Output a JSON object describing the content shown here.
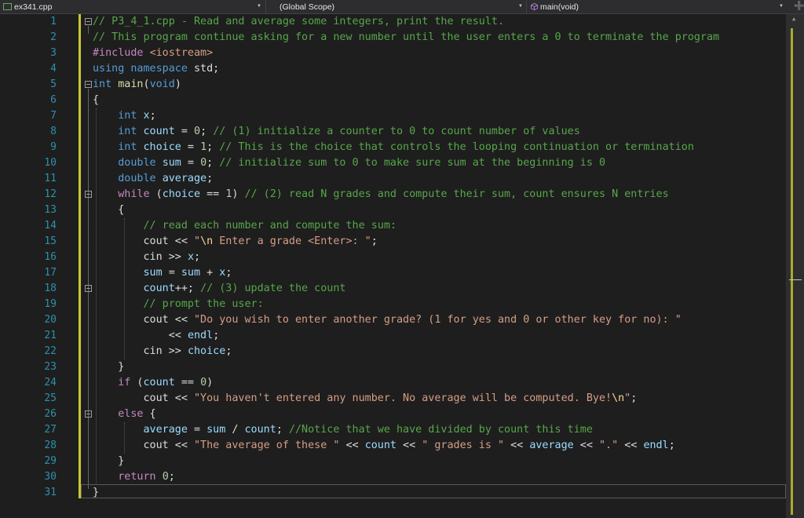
{
  "toolbar": {
    "file": "ex341.cpp",
    "scope": "(Global Scope)",
    "member": "main(void)",
    "split_glyph": "➕"
  },
  "line_numbers": [
    "1",
    "2",
    "3",
    "4",
    "5",
    "6",
    "7",
    "8",
    "9",
    "10",
    "11",
    "12",
    "13",
    "14",
    "15",
    "16",
    "17",
    "18",
    "19",
    "20",
    "21",
    "22",
    "23",
    "24",
    "25",
    "26",
    "27",
    "28",
    "29",
    "30",
    "31"
  ],
  "lines": [
    [
      [
        "c",
        "// P3_4_1.cpp - Read and average some integers, print the result."
      ]
    ],
    [
      [
        "c",
        "// This program continue asking for a new number until the user enters a 0 to terminate the program"
      ]
    ],
    [
      [
        "p",
        "#include "
      ],
      [
        "s",
        "<iostream>"
      ]
    ],
    [
      [
        "k",
        "using"
      ],
      [
        "t",
        " "
      ],
      [
        "k",
        "namespace"
      ],
      [
        "t",
        " std;"
      ]
    ],
    [
      [
        "k",
        "int"
      ],
      [
        "t",
        " "
      ],
      [
        "f",
        "main"
      ],
      [
        "t",
        "("
      ],
      [
        "k",
        "void"
      ],
      [
        "t",
        ")"
      ]
    ],
    [
      [
        "t",
        "{"
      ]
    ],
    [
      [
        "t",
        "    "
      ],
      [
        "k",
        "int"
      ],
      [
        "t",
        " "
      ],
      [
        "v",
        "x"
      ],
      [
        "t",
        ";"
      ]
    ],
    [
      [
        "t",
        "    "
      ],
      [
        "k",
        "int"
      ],
      [
        "t",
        " "
      ],
      [
        "v",
        "count"
      ],
      [
        "t",
        " = "
      ],
      [
        "n",
        "0"
      ],
      [
        "t",
        "; "
      ],
      [
        "c",
        "// (1) initialize a counter to 0 to count number of values"
      ]
    ],
    [
      [
        "t",
        "    "
      ],
      [
        "k",
        "int"
      ],
      [
        "t",
        " "
      ],
      [
        "v",
        "choice"
      ],
      [
        "t",
        " = "
      ],
      [
        "n",
        "1"
      ],
      [
        "t",
        "; "
      ],
      [
        "c",
        "// This is the choice that controls the looping continuation or termination"
      ]
    ],
    [
      [
        "t",
        "    "
      ],
      [
        "k",
        "double"
      ],
      [
        "t",
        " "
      ],
      [
        "v",
        "sum"
      ],
      [
        "t",
        " = "
      ],
      [
        "n",
        "0"
      ],
      [
        "t",
        "; "
      ],
      [
        "c",
        "// initialize sum to 0 to make sure sum at the beginning is 0"
      ]
    ],
    [
      [
        "t",
        "    "
      ],
      [
        "k",
        "double"
      ],
      [
        "t",
        " "
      ],
      [
        "v",
        "average"
      ],
      [
        "t",
        ";"
      ]
    ],
    [
      [
        "t",
        "    "
      ],
      [
        "p",
        "while"
      ],
      [
        "t",
        " ("
      ],
      [
        "v",
        "choice"
      ],
      [
        "t",
        " == "
      ],
      [
        "n",
        "1"
      ],
      [
        "t",
        ") "
      ],
      [
        "c",
        "// (2) read N grades and compute their sum, count ensures N entries"
      ]
    ],
    [
      [
        "t",
        "    {"
      ]
    ],
    [
      [
        "t",
        "        "
      ],
      [
        "c",
        "// read each number and compute the sum:"
      ]
    ],
    [
      [
        "t",
        "        cout << "
      ],
      [
        "s",
        "\""
      ],
      [
        "e",
        "\\n"
      ],
      [
        "s",
        " Enter a grade <Enter>: \""
      ],
      [
        "t",
        ";"
      ]
    ],
    [
      [
        "t",
        "        cin >> "
      ],
      [
        "v",
        "x"
      ],
      [
        "t",
        ";"
      ]
    ],
    [
      [
        "t",
        "        "
      ],
      [
        "v",
        "sum"
      ],
      [
        "t",
        " = "
      ],
      [
        "v",
        "sum"
      ],
      [
        "t",
        " + "
      ],
      [
        "v",
        "x"
      ],
      [
        "t",
        ";"
      ]
    ],
    [
      [
        "t",
        "        "
      ],
      [
        "v",
        "count"
      ],
      [
        "t",
        "++; "
      ],
      [
        "c",
        "// (3) update the count"
      ]
    ],
    [
      [
        "t",
        "        "
      ],
      [
        "c",
        "// prompt the user:"
      ]
    ],
    [
      [
        "t",
        "        cout << "
      ],
      [
        "s",
        "\"Do you wish to enter another grade? (1 for yes and 0 or other key for no): \""
      ]
    ],
    [
      [
        "t",
        "            << "
      ],
      [
        "v",
        "endl"
      ],
      [
        "t",
        ";"
      ]
    ],
    [
      [
        "t",
        "        cin >> "
      ],
      [
        "v",
        "choice"
      ],
      [
        "t",
        ";"
      ]
    ],
    [
      [
        "t",
        "    }"
      ]
    ],
    [
      [
        "t",
        "    "
      ],
      [
        "p",
        "if"
      ],
      [
        "t",
        " ("
      ],
      [
        "v",
        "count"
      ],
      [
        "t",
        " == "
      ],
      [
        "n",
        "0"
      ],
      [
        "t",
        ")"
      ]
    ],
    [
      [
        "t",
        "        cout << "
      ],
      [
        "s",
        "\"You haven't entered any number. No average will be computed. Bye!"
      ],
      [
        "e",
        "\\n"
      ],
      [
        "s",
        "\""
      ],
      [
        "t",
        ";"
      ]
    ],
    [
      [
        "t",
        "    "
      ],
      [
        "p",
        "else"
      ],
      [
        "t",
        " {"
      ]
    ],
    [
      [
        "t",
        "        "
      ],
      [
        "v",
        "average"
      ],
      [
        "t",
        " = "
      ],
      [
        "v",
        "sum"
      ],
      [
        "t",
        " / "
      ],
      [
        "v",
        "count"
      ],
      [
        "t",
        "; "
      ],
      [
        "c",
        "//Notice that we have divided by count this time"
      ]
    ],
    [
      [
        "t",
        "        cout << "
      ],
      [
        "s",
        "\"The average of these \""
      ],
      [
        "t",
        " << "
      ],
      [
        "v",
        "count"
      ],
      [
        "t",
        " << "
      ],
      [
        "s",
        "\" grades is \""
      ],
      [
        "t",
        " << "
      ],
      [
        "v",
        "average"
      ],
      [
        "t",
        " << "
      ],
      [
        "s",
        "\".\""
      ],
      [
        "t",
        " << "
      ],
      [
        "v",
        "endl"
      ],
      [
        "t",
        ";"
      ]
    ],
    [
      [
        "t",
        "    }"
      ]
    ],
    [
      [
        "t",
        "    "
      ],
      [
        "p",
        "return"
      ],
      [
        "t",
        " "
      ],
      [
        "n",
        "0"
      ],
      [
        "t",
        ";"
      ]
    ],
    [
      [
        "t",
        "}"
      ]
    ]
  ]
}
